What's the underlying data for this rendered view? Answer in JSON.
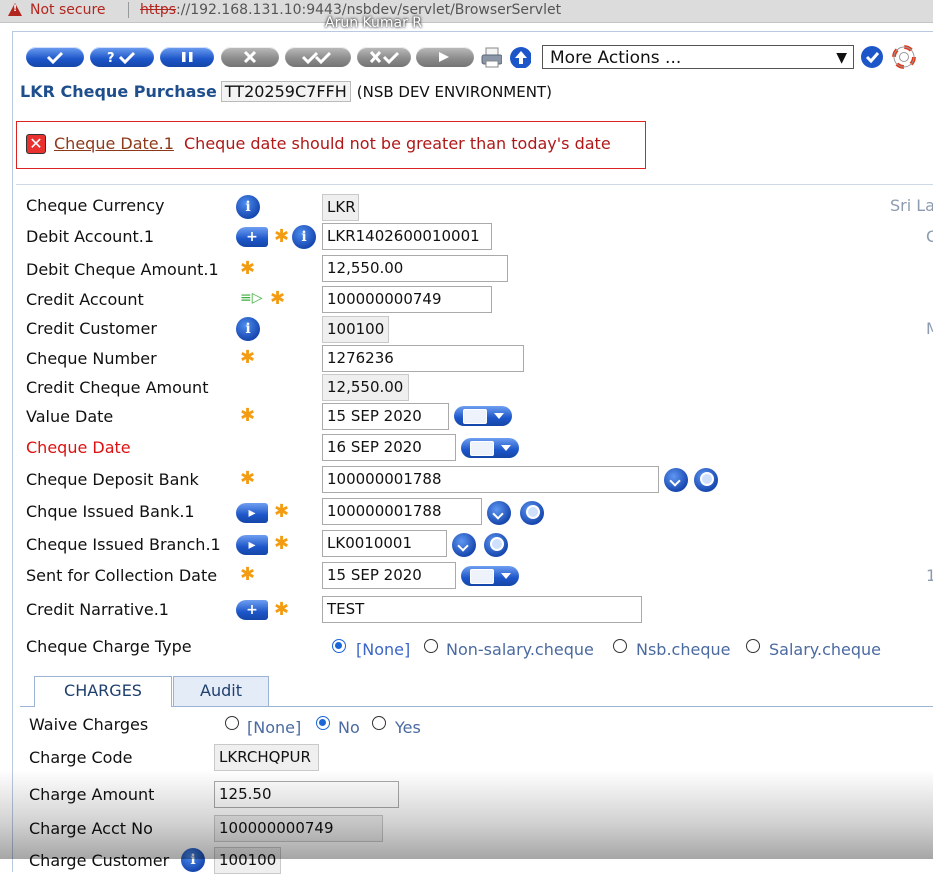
{
  "browser": {
    "security_label": "Not secure",
    "url_scheme": "https",
    "url_rest": "://192.168.131.10:9443/nsbdev/servlet/BrowserServlet",
    "user_overlay": "Arun Kumar R"
  },
  "toolbar": {
    "buttons": [
      {
        "name": "commit-button",
        "icon": "check"
      },
      {
        "name": "validate-button",
        "icon": "question-check",
        "label": "?"
      },
      {
        "name": "hold-button",
        "icon": "pause"
      },
      {
        "name": "delete-button",
        "icon": "cross"
      },
      {
        "name": "authorise-button",
        "icon": "double-check"
      },
      {
        "name": "reverse-button",
        "icon": "cross-check"
      },
      {
        "name": "next-button",
        "icon": "arrow-right"
      }
    ],
    "more_actions": "More Actions ...",
    "colors": {
      "accent": "#1d56c9",
      "disabled": "#8a8a8a"
    }
  },
  "header": {
    "title": "LKR Cheque Purchase",
    "transaction_id": "TT20259C7FFH",
    "environment": "(NSB DEV ENVIRONMENT)"
  },
  "error": {
    "field": "Cheque Date.1",
    "message": "Cheque date should not be greater than today's date",
    "color": "#b01818"
  },
  "form": {
    "cheque_currency": {
      "label": "Cheque Currency",
      "value": "LKR",
      "enrichment": "Sri La"
    },
    "debit_account": {
      "label": "Debit Account.1",
      "value": "LKR1402600010001",
      "enrichment": "C"
    },
    "debit_cheque_amount": {
      "label": "Debit Cheque Amount.1",
      "value": "12,550.00"
    },
    "credit_account": {
      "label": "Credit Account",
      "value": "100000000749"
    },
    "credit_customer": {
      "label": "Credit Customer",
      "value": "100100",
      "enrichment": "M"
    },
    "cheque_number": {
      "label": "Cheque Number",
      "value": "1276236"
    },
    "credit_cheque_amount": {
      "label": "Credit Cheque Amount",
      "value": "12,550.00"
    },
    "value_date": {
      "label": "Value Date",
      "value": "15 SEP 2020"
    },
    "cheque_date": {
      "label": "Cheque Date",
      "value": "16 SEP 2020"
    },
    "cheque_deposit_bank": {
      "label": "Cheque Deposit Bank",
      "value": "100000001788"
    },
    "cheque_issued_bank": {
      "label": "Chque Issued Bank.1",
      "value": "100000001788"
    },
    "cheque_issued_branch": {
      "label": "Cheque Issued Branch.1",
      "value": "LK0010001"
    },
    "sent_for_collection_date": {
      "label": "Sent for Collection Date",
      "value": "15 SEP 2020",
      "enrichment": "1"
    },
    "credit_narrative": {
      "label": "Credit Narrative.1",
      "value": "TEST"
    },
    "cheque_charge_type": {
      "label": "Cheque Charge Type",
      "options": [
        "[None]",
        "Non-salary.cheque",
        "Nsb.cheque",
        "Salary.cheque"
      ],
      "selected": "[None]"
    }
  },
  "tabs": [
    {
      "label": "CHARGES",
      "active": true
    },
    {
      "label": "Audit",
      "active": false
    }
  ],
  "charges": {
    "waive_charges": {
      "label": "Waive Charges",
      "options": [
        "[None]",
        "No",
        "Yes"
      ],
      "selected": "No"
    },
    "charge_code": {
      "label": "Charge Code",
      "value": "LKRCHQPUR"
    },
    "charge_amount": {
      "label": "Charge Amount",
      "value": "125.50"
    },
    "charge_acct_no": {
      "label": "Charge Acct No",
      "value": "100000000749"
    },
    "charge_customer": {
      "label": "Charge Customer",
      "value": "100100"
    }
  }
}
